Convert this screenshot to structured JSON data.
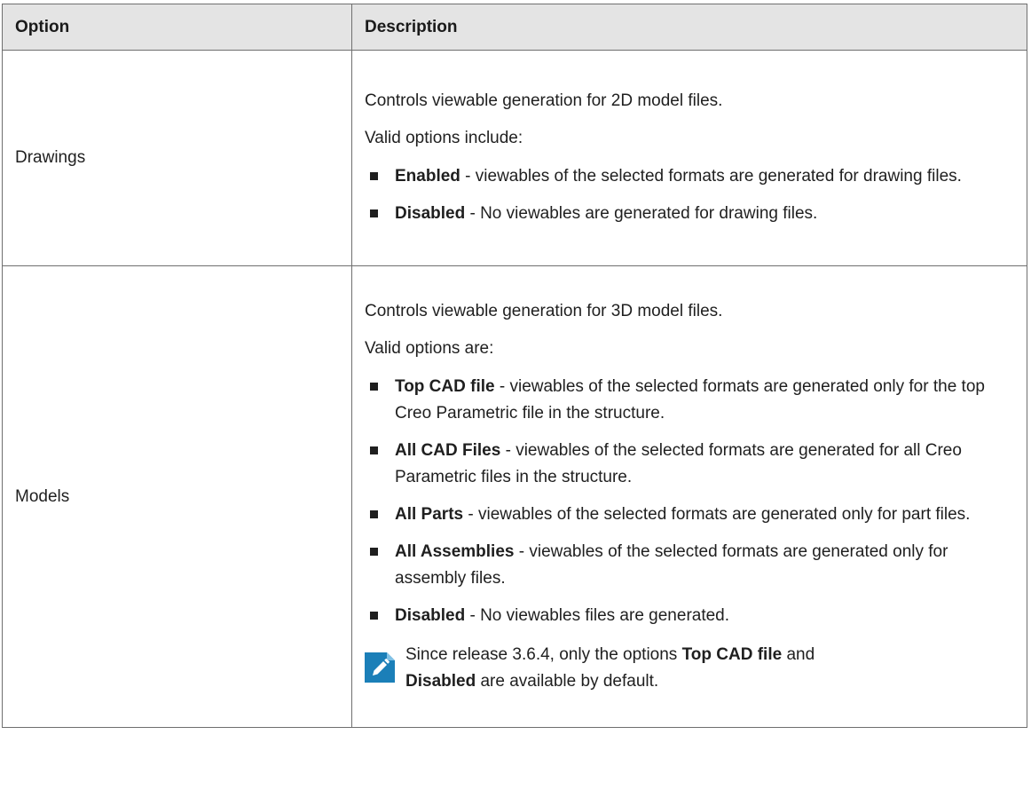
{
  "header": {
    "option": "Option",
    "description": "Description"
  },
  "rows": [
    {
      "option": "Drawings",
      "intro": "Controls viewable generation for 2D model files.",
      "valid_label": "Valid options include:",
      "items": [
        {
          "term": "Enabled",
          "text": " - viewables of the selected formats are generated for drawing files."
        },
        {
          "term": "Disabled",
          "text": " - No viewables are generated for drawing files."
        }
      ]
    },
    {
      "option": "Models",
      "intro": "Controls viewable generation for 3D model files.",
      "valid_label": "Valid options are:",
      "items": [
        {
          "term": "Top CAD file",
          "text": " - viewables of the selected formats are generated only for the top Creo Parametric file in the structure."
        },
        {
          "term": "All CAD Files",
          "text": " - viewables of the selected formats are generated for all Creo Parametric files in the structure."
        },
        {
          "term": "All Parts",
          "text": " - viewables of the selected formats are generated only for part files."
        },
        {
          "term": "All Assemblies",
          "text": " - viewables of the selected formats are generated only for assembly files."
        },
        {
          "term": "Disabled",
          "text": " - No viewables files are generated."
        }
      ],
      "note": {
        "icon": "pencil-note-icon",
        "text_before": "Since release 3.6.4, only the options ",
        "bold1": "Top CAD file",
        "text_middle": " and ",
        "bold2": "Disabled",
        "text_after": " are available by default."
      }
    }
  ],
  "colors": {
    "header_bg": "#e4e4e4",
    "border": "#6f6f6f",
    "note_icon_bg": "#1b7fb8"
  }
}
